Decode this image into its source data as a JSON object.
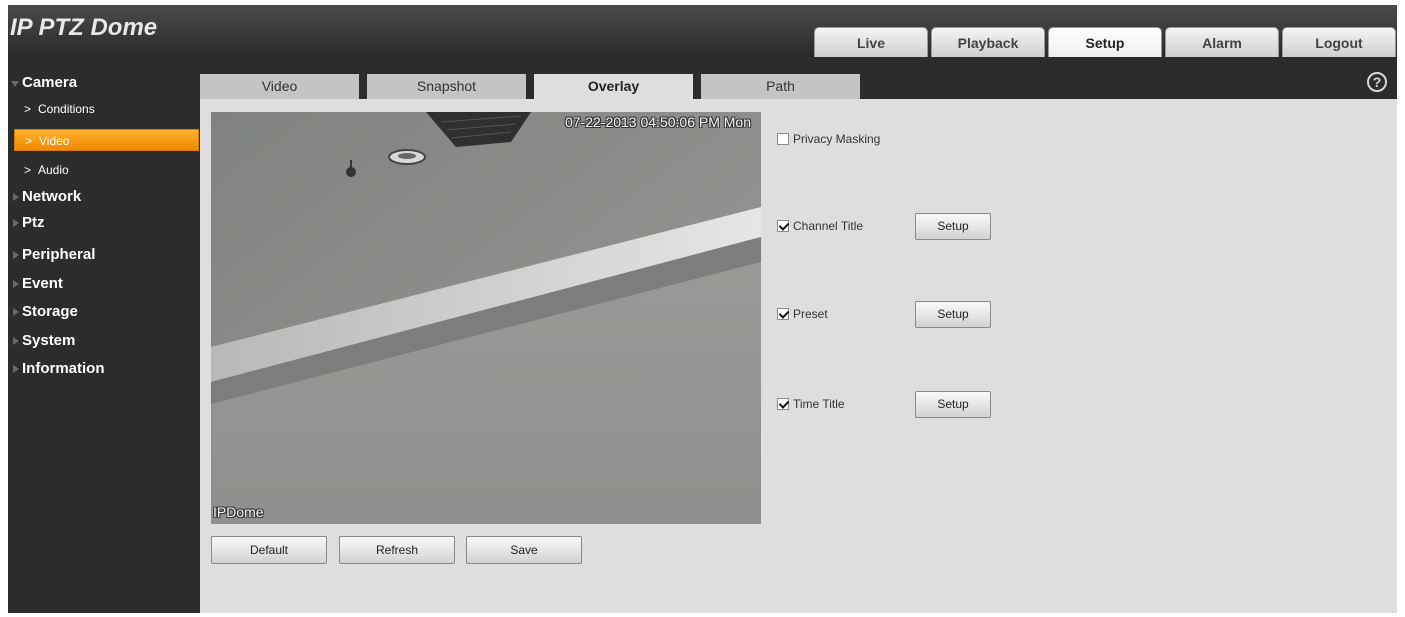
{
  "header": {
    "title": "IP PTZ Dome",
    "tabs": [
      {
        "label": "Live",
        "active": false
      },
      {
        "label": "Playback",
        "active": false
      },
      {
        "label": "Setup",
        "active": true
      },
      {
        "label": "Alarm",
        "active": false
      },
      {
        "label": "Logout",
        "active": false
      }
    ]
  },
  "sidebar": {
    "camera": {
      "label": "Camera",
      "expanded": true
    },
    "camera_items": [
      {
        "label": "Conditions",
        "active": false
      },
      {
        "label": "Video",
        "active": true
      },
      {
        "label": "Audio",
        "active": false
      }
    ],
    "sections": [
      {
        "label": "Network"
      },
      {
        "label": "Ptz"
      },
      {
        "label": "Peripheral"
      },
      {
        "label": "Event"
      },
      {
        "label": "Storage"
      },
      {
        "label": "System"
      },
      {
        "label": "Information"
      }
    ]
  },
  "tabs": [
    {
      "label": "Video",
      "active": false
    },
    {
      "label": "Snapshot",
      "active": false
    },
    {
      "label": "Overlay",
      "active": true
    },
    {
      "label": "Path",
      "active": false
    }
  ],
  "help": {
    "icon": "help-icon",
    "glyph": "?"
  },
  "video": {
    "osd_time": "07-22-2013 04:50:06 PM Mon",
    "osd_channel": "IPDome"
  },
  "options": {
    "privacy_masking": {
      "label": "Privacy Masking",
      "checked": false
    },
    "channel_title": {
      "label": "Channel Title",
      "checked": true,
      "button": "Setup"
    },
    "preset": {
      "label": "Preset",
      "checked": true,
      "button": "Setup"
    },
    "time_title": {
      "label": "Time Title",
      "checked": true,
      "button": "Setup"
    }
  },
  "actions": {
    "default": "Default",
    "refresh": "Refresh",
    "save": "Save"
  },
  "colors": {
    "active_orange": "#f08a00",
    "dark_bg": "#2c2c2c",
    "panel_bg": "#dedede"
  }
}
